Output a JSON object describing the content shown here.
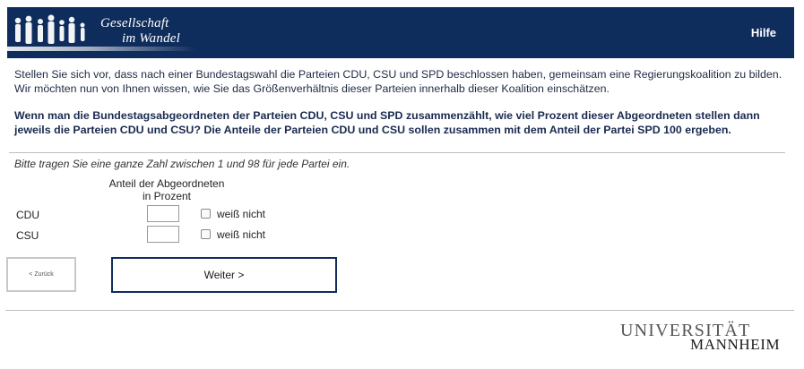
{
  "header": {
    "logo_line1": "Gesellschaft",
    "logo_line2": "im Wandel",
    "help_label": "Hilfe",
    "brand_color": "#0f2d5c"
  },
  "intro_text": "Stellen Sie sich vor, dass nach einer Bundestagswahl die Parteien CDU, CSU und SPD beschlossen haben, gemeinsam eine Regierungskoalition zu bilden. Wir möchten nun von Ihnen wissen, wie Sie das Größenverhältnis dieser Parteien innerhalb dieser Koalition einschätzen.",
  "question_text": "Wenn man die Bundestagsabgeordneten der Parteien CDU, CSU und SPD zusammenzählt, wie viel Prozent dieser Abgeordneten stellen dann jeweils die Parteien CDU und CSU? Die Anteile der Parteien CDU und CSU sollen zusammen mit dem Anteil der Partei SPD 100 ergeben.",
  "instruction_text": "Bitte tragen Sie eine ganze Zahl zwischen 1 und 98 für jede Partei ein.",
  "column_header_line1": "Anteil der Abgeordneten",
  "column_header_line2": "in Prozent",
  "rows": [
    {
      "label": "CDU",
      "value": "",
      "dont_know_label": "weiß nicht"
    },
    {
      "label": "CSU",
      "value": "",
      "dont_know_label": "weiß nicht"
    }
  ],
  "nav": {
    "back_label": "< Zurück",
    "next_label": "Weiter >"
  },
  "footer": {
    "university_line1": "UNIVERSITÄT",
    "university_line2": "MANNHEIM"
  }
}
